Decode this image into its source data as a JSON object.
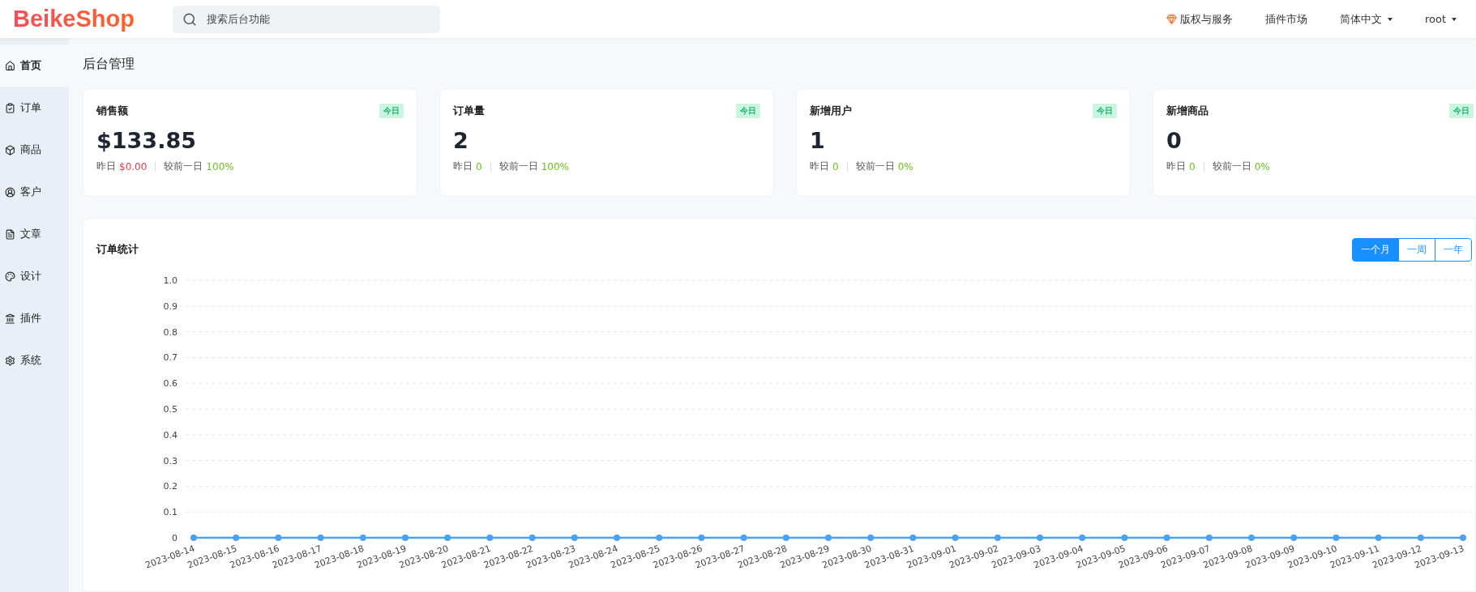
{
  "header": {
    "logo": "BeikeShop",
    "search": {
      "placeholder": "搜索后台功能"
    },
    "nav": [
      {
        "kind": "service",
        "label": "版权与服务"
      },
      {
        "kind": "link",
        "label": "插件市场"
      },
      {
        "kind": "dropdown",
        "label": "简体中文"
      },
      {
        "kind": "dropdown",
        "label": "root"
      }
    ]
  },
  "sidebar": {
    "items": [
      {
        "label": "首页",
        "selected": true
      },
      {
        "label": "订单",
        "selected": false
      },
      {
        "label": "商品",
        "selected": false
      },
      {
        "label": "客户",
        "selected": false
      },
      {
        "label": "文章",
        "selected": false
      },
      {
        "label": "设计",
        "selected": false
      },
      {
        "label": "插件",
        "selected": false
      },
      {
        "label": "系统",
        "selected": false
      }
    ]
  },
  "page_title": "后台管理",
  "cards": [
    {
      "title": "销售额",
      "badge": "今日",
      "value": "$133.85",
      "yesterday_label": "昨日",
      "yesterday": {
        "text": "$0.00",
        "color": "#e83a4f"
      },
      "compare_label": "较前一日",
      "compare": "100%"
    },
    {
      "title": "订单量",
      "badge": "今日",
      "value": "2",
      "yesterday_label": "昨日",
      "yesterday": {
        "text": "0",
        "color": "#6ac21d"
      },
      "compare_label": "较前一日",
      "compare": "100%"
    },
    {
      "title": "新增用户",
      "badge": "今日",
      "value": "1",
      "yesterday_label": "昨日",
      "yesterday": {
        "text": "0",
        "color": "#6ac21d"
      },
      "compare_label": "较前一日",
      "compare": "0%"
    },
    {
      "title": "新增商品",
      "badge": "今日",
      "value": "0",
      "yesterday_label": "昨日",
      "yesterday": {
        "text": "0",
        "color": "#6ac21d"
      },
      "compare_label": "较前一日",
      "compare": "0%"
    }
  ],
  "order_stats": {
    "title": "订单统计",
    "ranges": [
      {
        "label": "一个月",
        "selected": true
      },
      {
        "label": "一周",
        "selected": false
      },
      {
        "label": "一年",
        "selected": false
      }
    ],
    "chart_data": {
      "type": "line",
      "categories": [
        "2023-08-14",
        "2023-08-15",
        "2023-08-16",
        "2023-08-17",
        "2023-08-18",
        "2023-08-19",
        "2023-08-20",
        "2023-08-21",
        "2023-08-22",
        "2023-08-23",
        "2023-08-24",
        "2023-08-25",
        "2023-08-26",
        "2023-08-27",
        "2023-08-28",
        "2023-08-29",
        "2023-08-30",
        "2023-08-31",
        "2023-09-01",
        "2023-09-02",
        "2023-09-03",
        "2023-09-04",
        "2023-09-05",
        "2023-09-06",
        "2023-09-07",
        "2023-09-08",
        "2023-09-09",
        "2023-09-10",
        "2023-09-11",
        "2023-09-12",
        "2023-09-13"
      ],
      "grid": true,
      "series": [
        {
          "color": "#4ba3f0",
          "marker": true,
          "values": [
            0,
            0,
            0,
            0,
            0,
            0,
            0,
            0,
            0,
            0,
            0,
            0,
            0,
            0,
            0,
            0,
            0,
            0,
            0,
            0,
            0,
            0,
            0,
            0,
            0,
            0,
            0,
            0,
            0,
            0,
            0
          ]
        }
      ],
      "ylim": [
        0,
        1
      ],
      "yticks": [
        0,
        0.1,
        0.2,
        0.3,
        0.4,
        0.5,
        0.6,
        0.7,
        0.8,
        0.9,
        {
          "value": 1,
          "label": "1.0"
        }
      ]
    }
  }
}
